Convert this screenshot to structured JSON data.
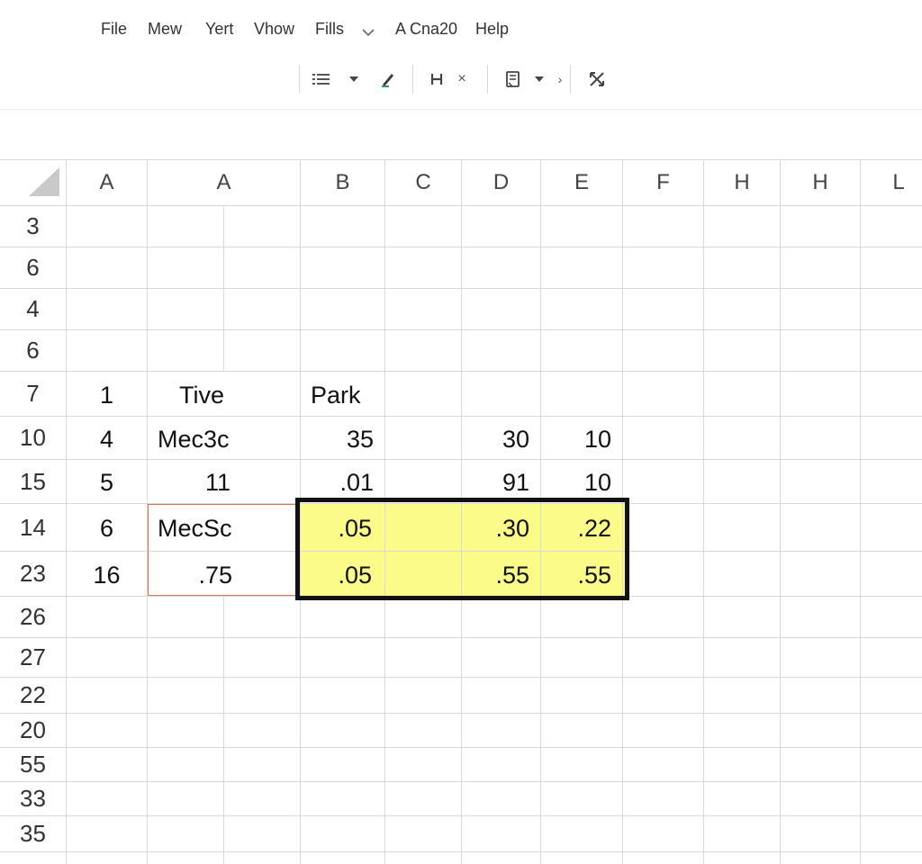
{
  "menu": [
    "File",
    "Mew",
    "Yert",
    "Vhow",
    "Fills",
    "A Cna20",
    "Help"
  ],
  "toolbar": {
    "icons": [
      "list-icon",
      "dropdown-arrow-icon",
      "pen-icon",
      "h-icon",
      "close-icon",
      "clipboard-icon",
      "dropdown-arrow-icon",
      "small-chevron-icon",
      "crossed-arrows-icon"
    ],
    "close_glyph": "×",
    "small_glyph": "›"
  },
  "sheet": {
    "columns": [
      "A",
      "A",
      "B",
      "C",
      "D",
      "E",
      "F",
      "H",
      "H",
      "L"
    ],
    "rows": [
      "3",
      "6",
      "4",
      "6",
      "7",
      "10",
      "15",
      "14",
      "23",
      "26",
      "27",
      "22",
      "20",
      "55",
      "33",
      "35"
    ],
    "cells": {
      "r7": {
        "a1": "1",
        "a2": "Tive",
        "b": "Park"
      },
      "r10": {
        "a1": "4",
        "a2": "Mec3c",
        "b": "35",
        "d": "30",
        "e": "10"
      },
      "r15": {
        "a1": "5",
        "a2": "11",
        "b": ".01",
        "d": "91",
        "e": "10"
      },
      "r14": {
        "a1": "6",
        "a2": "MecSc",
        "b": ".05",
        "d": ".30",
        "e": ".22"
      },
      "r23": {
        "a1": "16",
        "a2": ".75",
        "b": ".05",
        "d": ".55",
        "e": ".55"
      }
    },
    "colors": {
      "highlight": "#fbfb8a",
      "selection_border": "#111111",
      "accent_border": "#d9794a",
      "gridline": "#d9d9d9"
    }
  }
}
